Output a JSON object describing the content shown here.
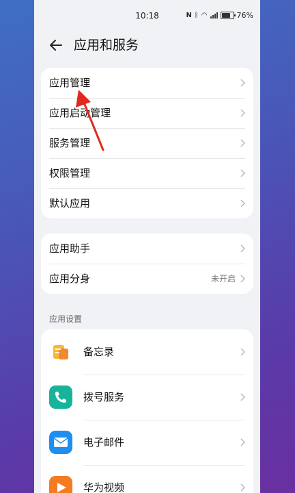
{
  "status": {
    "time": "10:18",
    "battery": "76%"
  },
  "header": {
    "title": "应用和服务"
  },
  "card1": {
    "items": [
      {
        "label": "应用管理"
      },
      {
        "label": "应用启动管理"
      },
      {
        "label": "服务管理"
      },
      {
        "label": "权限管理"
      },
      {
        "label": "默认应用"
      }
    ]
  },
  "card2": {
    "items": [
      {
        "label": "应用助手"
      },
      {
        "label": "应用分身",
        "value": "未开启"
      }
    ]
  },
  "section_title": "应用设置",
  "apps": [
    {
      "label": "备忘录",
      "icon": "notes-icon"
    },
    {
      "label": "拨号服务",
      "icon": "phone-icon"
    },
    {
      "label": "电子邮件",
      "icon": "email-icon"
    },
    {
      "label": "华为视频",
      "icon": "video-icon"
    }
  ],
  "colors": {
    "annotation_arrow": "#e02a20"
  }
}
